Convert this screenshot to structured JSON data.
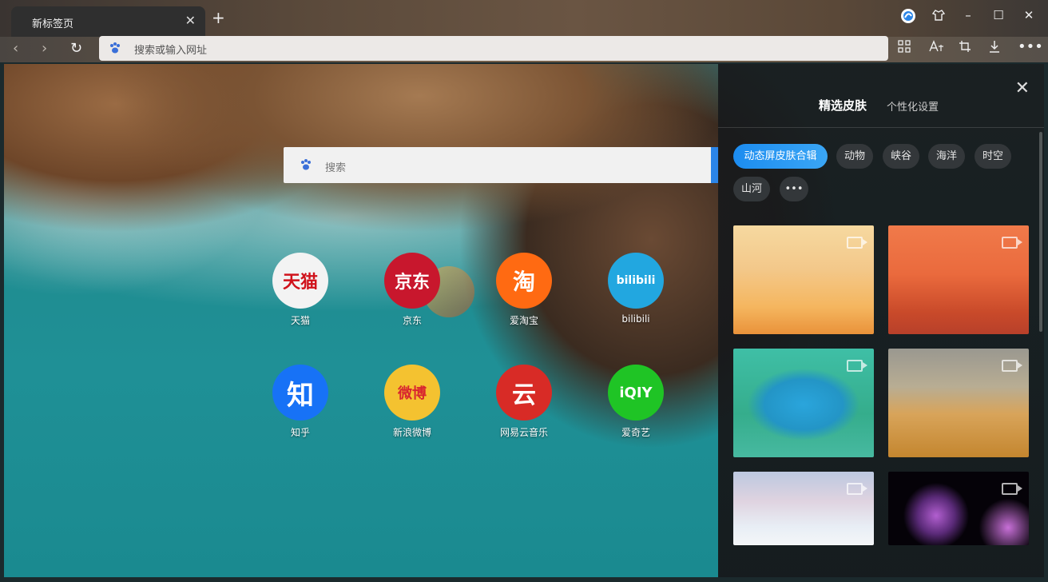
{
  "browser": {
    "tab_title": "新标签页",
    "address_placeholder": "搜索或输入网址"
  },
  "search": {
    "placeholder": "搜索"
  },
  "shortcuts": [
    {
      "label": "天猫",
      "icon_text": "天猫",
      "color": "#f3f3f3"
    },
    {
      "label": "京东",
      "icon_text": "京东",
      "color": "#c8172d"
    },
    {
      "label": "爱淘宝",
      "icon_text": "淘",
      "color": "#ff6a12"
    },
    {
      "label": "bilibili",
      "icon_text": "bilibili",
      "color": "#22a7e0"
    },
    {
      "label": "知乎",
      "icon_text": "知",
      "color": "#1772f6"
    },
    {
      "label": "新浪微博",
      "icon_text": "微博",
      "color": "#f4c230"
    },
    {
      "label": "网易云音乐",
      "icon_text": "云",
      "color": "#d82b26"
    },
    {
      "label": "爱奇艺",
      "icon_text": "iQIY",
      "color": "#1fc425"
    }
  ],
  "skin_panel": {
    "tab_selected": "精选皮肤",
    "tab_other": "个性化设置",
    "categories": [
      "动态屏皮肤合辑",
      "动物",
      "峡谷",
      "海洋",
      "时空",
      "山河"
    ],
    "more_label": "•••"
  },
  "colors": {
    "accent": "#2b85e8",
    "panel_bg": "#181a1c"
  }
}
